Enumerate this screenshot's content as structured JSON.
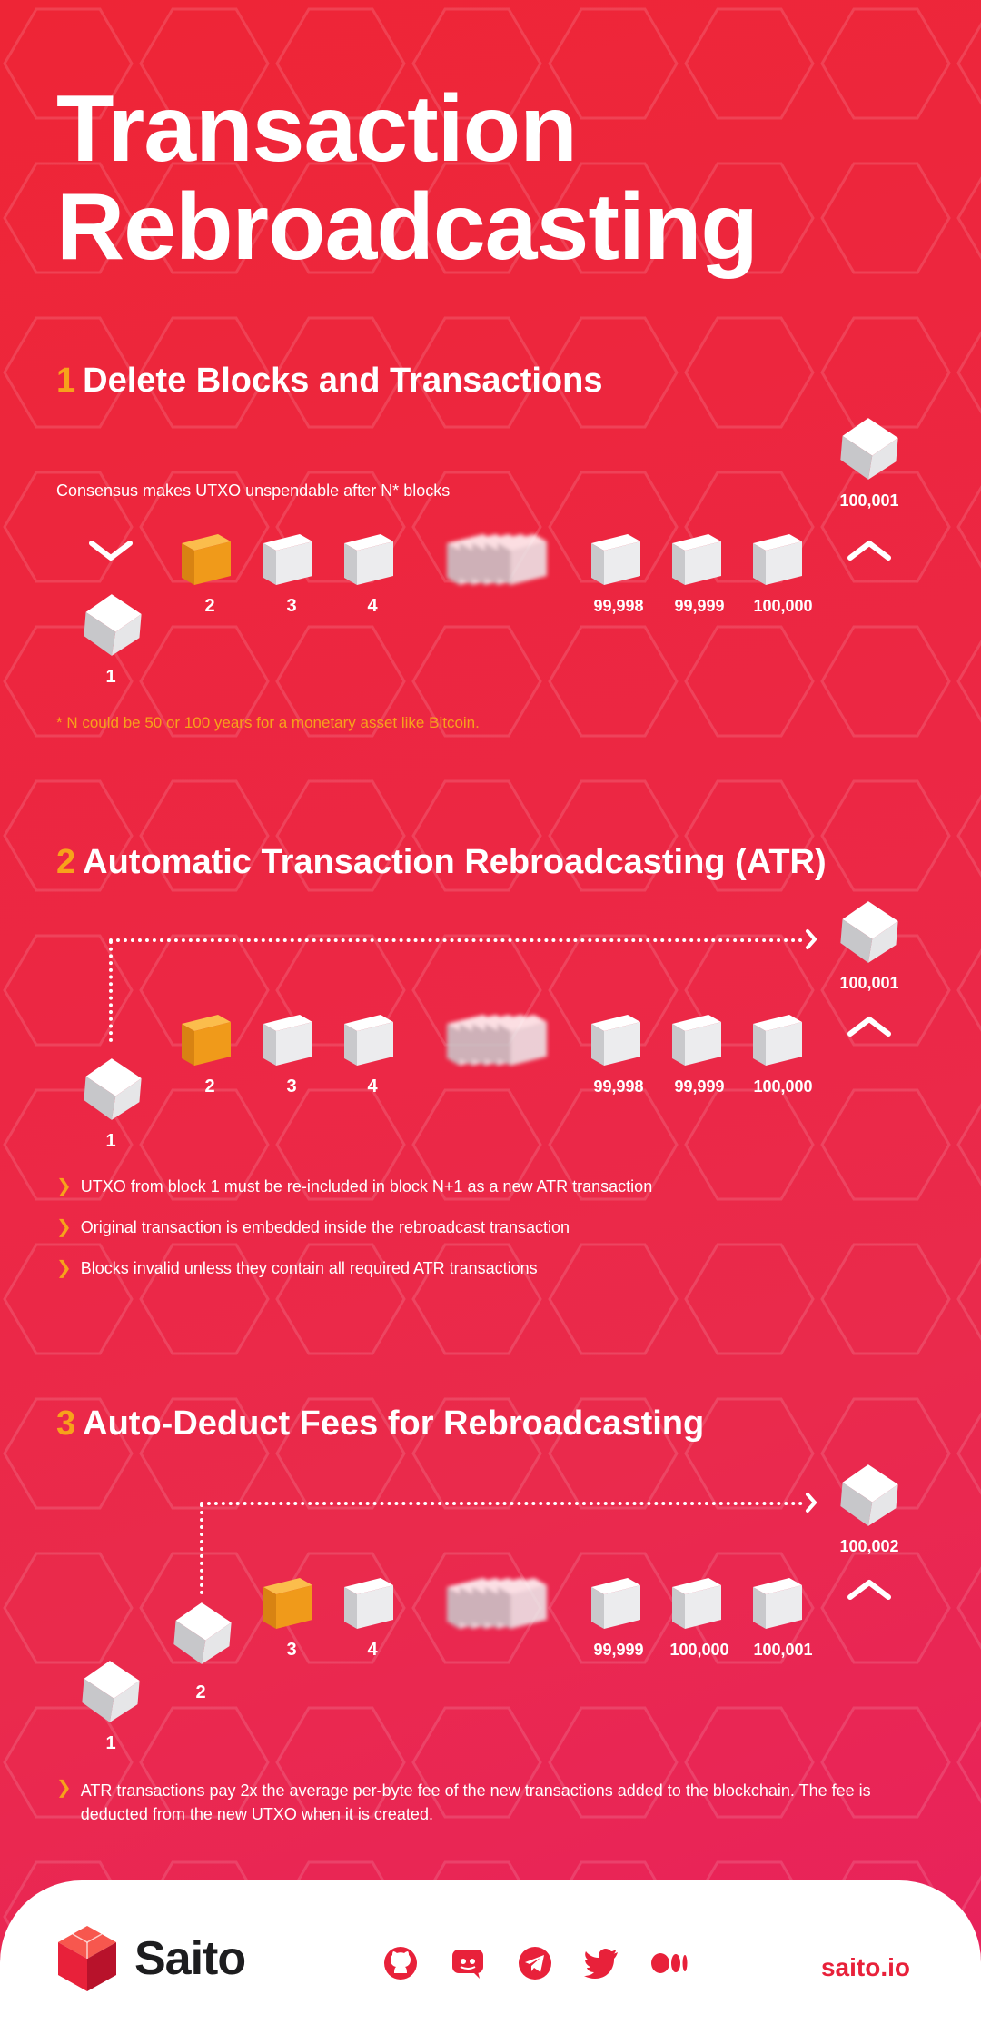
{
  "title": {
    "line1": "Transaction",
    "line2": "Rebroadcasting"
  },
  "section1": {
    "num": "1",
    "heading": "Delete Blocks and Transactions",
    "caption": "Consensus makes UTXO unspendable after N* blocks",
    "labels": [
      "1",
      "2",
      "3",
      "4",
      "99,998",
      "99,999",
      "100,000",
      "100,001"
    ],
    "note": "* N could be 50 or 100 years for a monetary asset like Bitcoin."
  },
  "section2": {
    "num": "2",
    "heading": "Automatic Transaction Rebroadcasting (ATR)",
    "labels": [
      "1",
      "2",
      "3",
      "4",
      "99,998",
      "99,999",
      "100,000",
      "100,001"
    ],
    "bullets": [
      "UTXO from block 1 must be re-included in block N+1 as a new ATR transaction",
      "Original transaction is embedded inside the rebroadcast transaction",
      "Blocks invalid unless they contain all required ATR transactions"
    ]
  },
  "section3": {
    "num": "3",
    "heading": "Auto-Deduct Fees for Rebroadcasting",
    "labels": [
      "1",
      "2",
      "3",
      "4",
      "99,999",
      "100,000",
      "100,001",
      "100,002"
    ],
    "bullet": "ATR transactions pay 2x the average per-byte fee of the new transactions added to the blockchain. The fee is deducted from the new UTXO when it is created."
  },
  "footer": {
    "brand": "Saito",
    "logo_icon": "saito-logo-icon",
    "socials": [
      "github-icon",
      "discord-icon",
      "telegram-icon",
      "twitter-icon",
      "medium-icon"
    ],
    "site": "saito.io"
  },
  "colors": {
    "accent": "#f7a21b",
    "background": "#ee2536",
    "brand": "#e8213a"
  }
}
